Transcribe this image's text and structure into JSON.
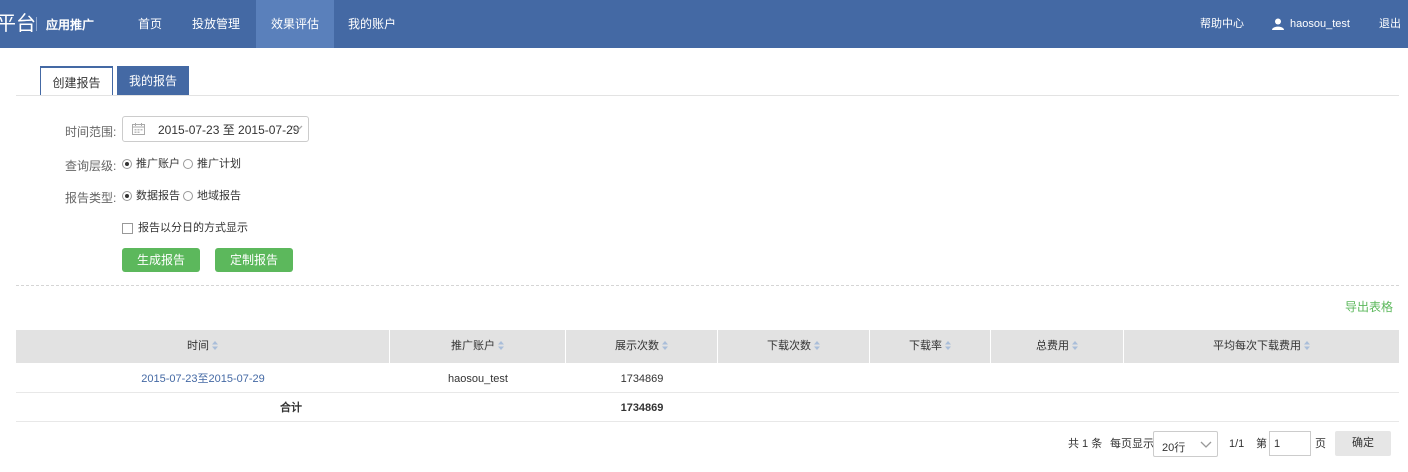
{
  "header": {
    "logo": "平台",
    "app_name": "应用推广",
    "nav": [
      "首页",
      "投放管理",
      "效果评估",
      "我的账户"
    ],
    "active_nav": "效果评估",
    "help": "帮助中心",
    "username": "haosou_test",
    "logout": "退出"
  },
  "tabs": {
    "create": "创建报告",
    "mine": "我的报告"
  },
  "form": {
    "time_range_label": "时间范围:",
    "date_range": "2015-07-23 至 2015-07-29",
    "level_label": "查询层级:",
    "level_options": [
      "推广账户",
      "推广计划"
    ],
    "level_selected": "推广账户",
    "type_label": "报告类型:",
    "type_options": [
      "数据报告",
      "地域报告"
    ],
    "type_selected": "数据报告",
    "daily_checkbox_label": "报告以分日的方式显示",
    "daily_checked": false,
    "generate_button": "生成报告",
    "custom_button": "定制报告"
  },
  "export_label": "导出表格",
  "table": {
    "columns": [
      "时间",
      "推广账户",
      "展示次数",
      "下载次数",
      "下载率",
      "总费用",
      "平均每次下载费用"
    ],
    "rows": [
      [
        "2015-07-23至2015-07-29",
        "haosou_test",
        "1734869",
        "",
        "",
        "",
        ""
      ]
    ],
    "total": {
      "label": "合计",
      "impressions": "1734869"
    }
  },
  "pager": {
    "total": "共 1 条",
    "per_page_label": "每页显示",
    "per_page": "20行",
    "page_info": "1/1",
    "goto_prefix": "第",
    "goto_value": "1",
    "goto_suffix": "页",
    "confirm": "确定"
  },
  "colors": {
    "nav_bg": "#4469a4",
    "nav_active": "#5a80bb",
    "green": "#5cb85c",
    "link": "#4469a4"
  }
}
